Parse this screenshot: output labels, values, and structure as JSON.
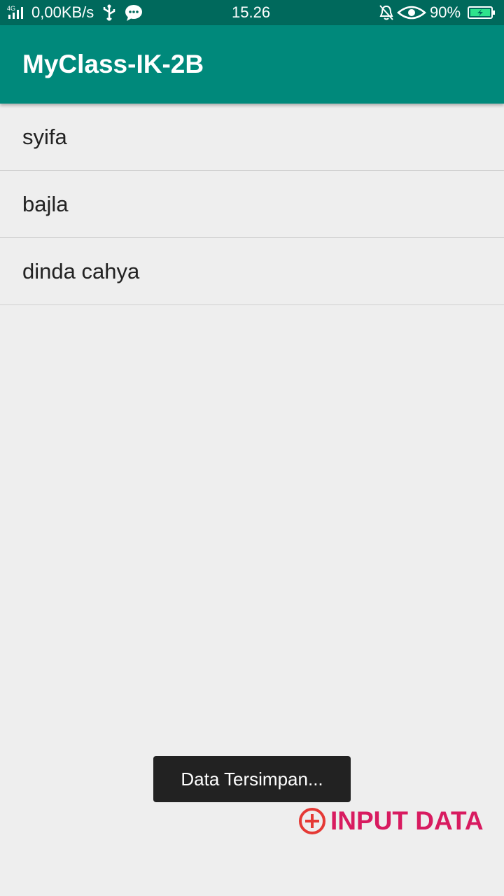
{
  "status_bar": {
    "network": "4G",
    "speed": "0,00KB/s",
    "time": "15.26",
    "battery_pct": "90%",
    "icons": [
      "signal-icon",
      "usb-icon",
      "message-icon",
      "bell-off-icon",
      "eye-icon",
      "battery-icon"
    ]
  },
  "app_bar": {
    "title": "MyClass-IK-2B"
  },
  "list": {
    "items": [
      {
        "label": "syifa"
      },
      {
        "label": "bajla"
      },
      {
        "label": "dinda cahya"
      }
    ]
  },
  "toast": {
    "text": "Data Tersimpan..."
  },
  "input_button": {
    "label": "INPUT DATA"
  },
  "colors": {
    "status_bar": "#00695C",
    "app_bar": "#00897B",
    "background": "#EEEEEE",
    "accent": "#D81B60",
    "plus_icon": "#E53935"
  }
}
